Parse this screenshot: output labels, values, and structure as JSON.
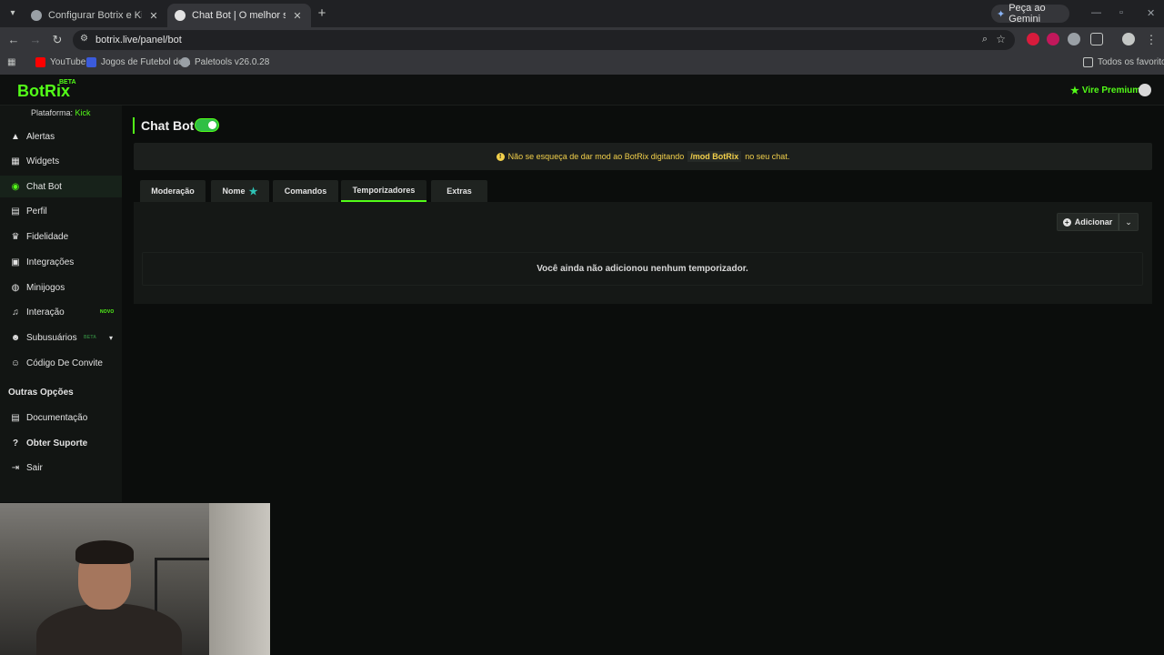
{
  "browser": {
    "tabs": [
      {
        "title": "Configurar Botrix e KickBot",
        "favicon_color": "#9aa0a6"
      },
      {
        "title": "Chat Bot | O melhor software p",
        "favicon_color": "#e3e3e3"
      }
    ],
    "gemini_label": "Peça ao Gemini",
    "url": "botrix.live/panel/bot",
    "bookmarks": [
      {
        "label": "YouTube",
        "icon": "youtube-icon",
        "color": "#ff0000"
      },
      {
        "label": "Jogos de Futebol de...",
        "icon": "game-icon",
        "color": "#3b5bdb"
      },
      {
        "label": "Paletools v26.0.28",
        "icon": "globe-icon",
        "color": "#9aa0a6"
      }
    ],
    "all_bookmarks_label": "Todos os favoritos"
  },
  "app": {
    "logo": "BotRix",
    "logo_badge": "BETA",
    "premium_label": "Vire Premium",
    "platform_label": "Plataforma:",
    "platform_value": "Kick",
    "accent": "#53fc18",
    "sidebar": [
      {
        "label": "Alertas",
        "icon": "alert-icon",
        "glyph": "▲"
      },
      {
        "label": "Widgets",
        "icon": "widgets-icon",
        "glyph": "▦"
      },
      {
        "label": "Chat Bot",
        "icon": "robot-icon",
        "glyph": "◉",
        "active": true
      },
      {
        "label": "Perfil",
        "icon": "profile-icon",
        "glyph": "▤"
      },
      {
        "label": "Fidelidade",
        "icon": "trophy-icon",
        "glyph": "♛"
      },
      {
        "label": "Integrações",
        "icon": "integrations-icon",
        "glyph": "▣"
      },
      {
        "label": "Minijogos",
        "icon": "gamepad-icon",
        "glyph": "◍"
      },
      {
        "label": "Interação",
        "icon": "music-icon",
        "glyph": "♫",
        "badge": "NOVO"
      },
      {
        "label": "Subusuários",
        "icon": "users-icon",
        "glyph": "☻",
        "badge": "BETA"
      },
      {
        "label": "Código De Convite",
        "icon": "invite-icon",
        "glyph": "☺"
      }
    ],
    "other_options_title": "Outras Opções",
    "other_options": [
      {
        "label": "Documentação",
        "icon": "docs-icon",
        "glyph": "▤"
      },
      {
        "label": "Obter Suporte",
        "icon": "help-icon",
        "glyph": "?"
      },
      {
        "label": "Sair",
        "icon": "logout-icon",
        "glyph": "⇥"
      }
    ]
  },
  "main": {
    "title": "Chat Bot",
    "bot_enabled": true,
    "notice": {
      "before": "Não se esqueça de dar mod ao BotRix digitando",
      "command": "/mod BotRix",
      "after": "no seu chat."
    },
    "tabs": [
      "Moderação",
      "Nome",
      "Comandos",
      "Temporizadores",
      "Extras"
    ],
    "active_tab": "Temporizadores",
    "add_button": "Adicionar",
    "empty_message": "Você ainda não adicionou nenhum temporizador."
  }
}
